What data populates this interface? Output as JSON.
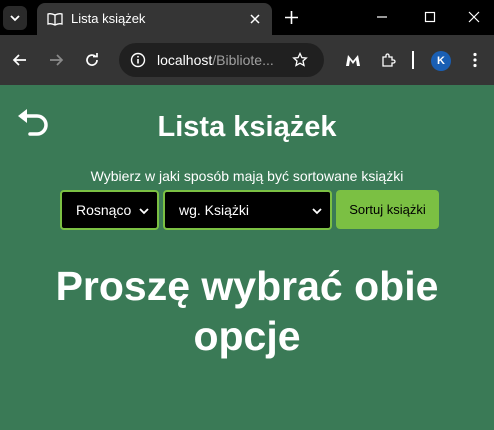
{
  "browser": {
    "tab": {
      "title": "Lista książek",
      "favicon": "book-icon"
    },
    "address": {
      "host": "localhost",
      "path": "/Bibliote..."
    },
    "profile_initial": "K"
  },
  "page": {
    "title": "Lista książek",
    "instruction": "Wybierz w jaki sposób mają być sortowane książki",
    "order_select": {
      "value": "Rosnąco"
    },
    "field_select": {
      "value": "wg. Książki"
    },
    "sort_button": "Sortuj książki",
    "message": "Proszę wybrać obie opcje"
  },
  "colors": {
    "background": "#3a7a56",
    "accent": "#7bc043",
    "select_bg": "#000000"
  }
}
